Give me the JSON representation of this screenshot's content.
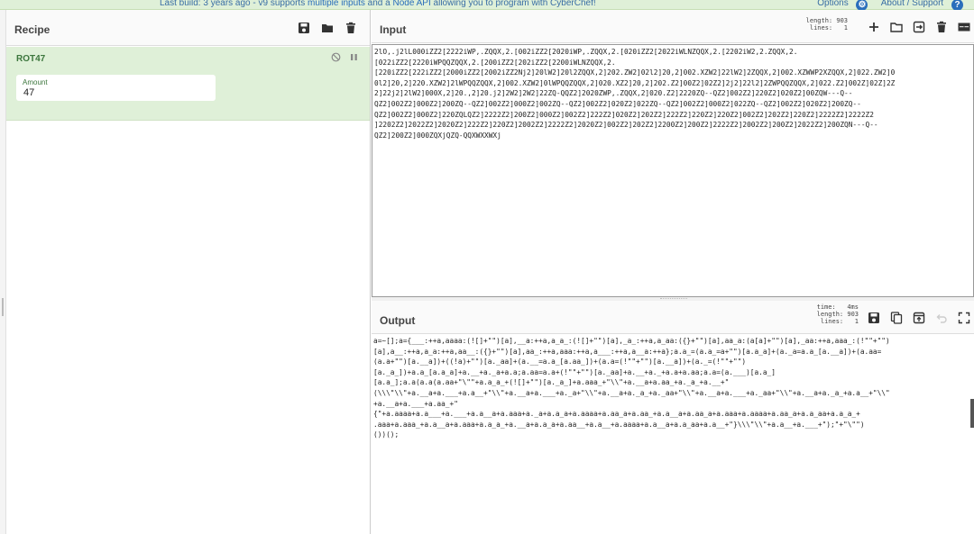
{
  "banner": {
    "text_prefix": "Last build: 3 years ago - v9 supports ",
    "link1": "multiple inputs",
    "text_mid": " and a ",
    "link2": "Node API",
    "text_suffix": " allowing you to program with CyberChef!",
    "options_label": "Options",
    "about_label": "About / Support"
  },
  "recipe": {
    "title": "Recipe",
    "operation": {
      "name": "ROT47",
      "arg_label": "Amount",
      "arg_value": "47"
    }
  },
  "input": {
    "title": "Input",
    "stats": "length: 903\n lines:   1",
    "text": "2lO,.j2lL000iZZ2[2222iWP,.ZQQX,2.[002iZZ2[2020iWP,.ZQQX,2.[020iZZ2[2022iWLNZQQX,2.[2202iW2,2.ZQQX,2.\n[022iZZ2[2220iWPQQZQQX,2.[200iZZ2[202iZZ2[2200iWLNZQQX,2.\n[220iZZ2[222iZZ2[2000iZZ2[2002iZZ2Nj2]20lW2]20l2ZQQX,2]202.ZW2]02l2]20,2]002.XZW2]22lW2]2ZQQX,2]002.XZWWP2XZQQX,2]022.ZW2]0\n0l2]20,2]220.XZW2]2lWPQQZQQX,2]002.XZW2]0lWPQQZQQX,2]020.XZ2]20,2]202.Z2]00Z2]02Z2]2j2]22l2]2ZWPQQZQQX,2]022.Z2]002Z]02Z]2Z\n2]22j2]2lW2]000X,2]20.,2]20.j2]2W2]2W2]22ZQ-QQZ2]2020ZWP,.ZQQX,2]020.Z2]2220ZQ--QZ2]002Z2]220Z2]020Z2]00ZQW---Q--\nQZ2]002Z2]000Z2]200ZQ--QZ2]002Z2]000Z2]002ZQ--QZ2]002Z2]020Z2]022ZQ--QZ2]002Z2]000Z2]022ZQ--QZ2]002Z2]020Z2]200ZQ--\nQZ2]002Z2]000Z2]220ZQLQZ2]2222Z2]200Z2]000Z2]002Z2]222Z2]020Z2]202Z2]222Z2]220Z2]220Z2]002Z2]202Z2]220Z2]2222Z2]2222Z2\n]2202Z2]2022Z2]2020Z2]222Z2]220Z2]2002Z2]2222Z2]2020Z2]002Z2]202Z2]2200Z2]200Z2]2222Z2]2002Z2]200Z2]2022Z2]200ZQN---Q--\nQZ2]200Z2]000ZQXjQZQ-QQXWXXWXj"
  },
  "output": {
    "title": "Output",
    "stats": "  time:   4ms\nlength: 903\n lines:   1",
    "text": "a=~[];a={___:++a,aaaa:(![]+\"\")[a],__a:++a,a_a_:(![]+\"\")[a],_a_:++a,a_aa:({}+\"\")[a],aa_a:(a[a]+\"\")[a],_aa:++a,aaa_:(!\"\"+\"\")\n[a],a__:++a,a_a:++a,aa__:({}+\"\")[a],aa_:++a,aaa:++a,a___:++a,a__a:++a};a.a_=(a.a_=a+\"\")[a.a_a]+(a._a=a.a_[a.__a])+(a.aa=\n(a.a+\"\")[a.__a])+((!a)+\"\")[a._aa]+(a.__=a.a_[a.aa_])+(a.a=(!\"\"+\"\")[a.__a])+(a._=(!\"\"+\"\")\n[a._a_])+a.a_[a.a_a]+a.__+a._a+a.a;a.aa=a.a+(!\"\"+\"\")[a._aa]+a.__+a._+a.a+a.aa;a.a=(a.___)[a.a_]\n[a.a_];a.a(a.a(a.aa+\"\\\"\"+a.a_a_+(![]+\"\")[a._a_]+a.aaa_+\"\\\\\"+a.__a+a.aa_+a._a_+a.__+\"\n(\\\\\\\"\\\\\"+a.__a+a.___+a.a__+\"\\\\\"+a.__a+a.___+a._a+\"\\\\\"+a.__a+a._a_+a._aa+\"\\\\\"+a.__a+a.___+a._aa+\"\\\\\"+a.__a+a._a_+a.a__+\"\\\\\"\n+a.__a+a.___+a.aa_+\"\n{\"+a.aaaa+a.a___+a.___+a.a__a+a.aaa+a._a+a.a_a+a.aaaa+a.aa_a+a.aa_+a.a__a+a.aa_a+a.aaa+a.aaaa+a.aa_a+a.a_aa+a.a_a_+\n.aaa+a.aaa_+a.a__a+a.aaa+a.a_a_+a.__a+a.a_a+a.aa__+a.a__+a.aaaa+a.a__a+a.a_aa+a.a__+\"}\\\\\\\"\\\\\"+a.a__+a.___+\");\"+\"\\\"\")\n())();"
  },
  "colors": {
    "banner_bg": "#dff0d8",
    "operation_bg": "#dff0d8",
    "operation_text": "#3c763d",
    "link": "#2a6ebb"
  },
  "icons": {
    "recipe": [
      "save-icon",
      "folder-icon",
      "trash-icon"
    ],
    "input": [
      "plus-icon",
      "folder-icon",
      "import-icon",
      "trash-icon",
      "layout-icon"
    ],
    "output": [
      "save-icon",
      "copy-icon",
      "replace-input-icon",
      "undo-icon",
      "fullscreen-icon"
    ],
    "operation": [
      "disable-icon",
      "pause-icon"
    ],
    "banner": [
      "gear-icon",
      "help-icon"
    ]
  }
}
